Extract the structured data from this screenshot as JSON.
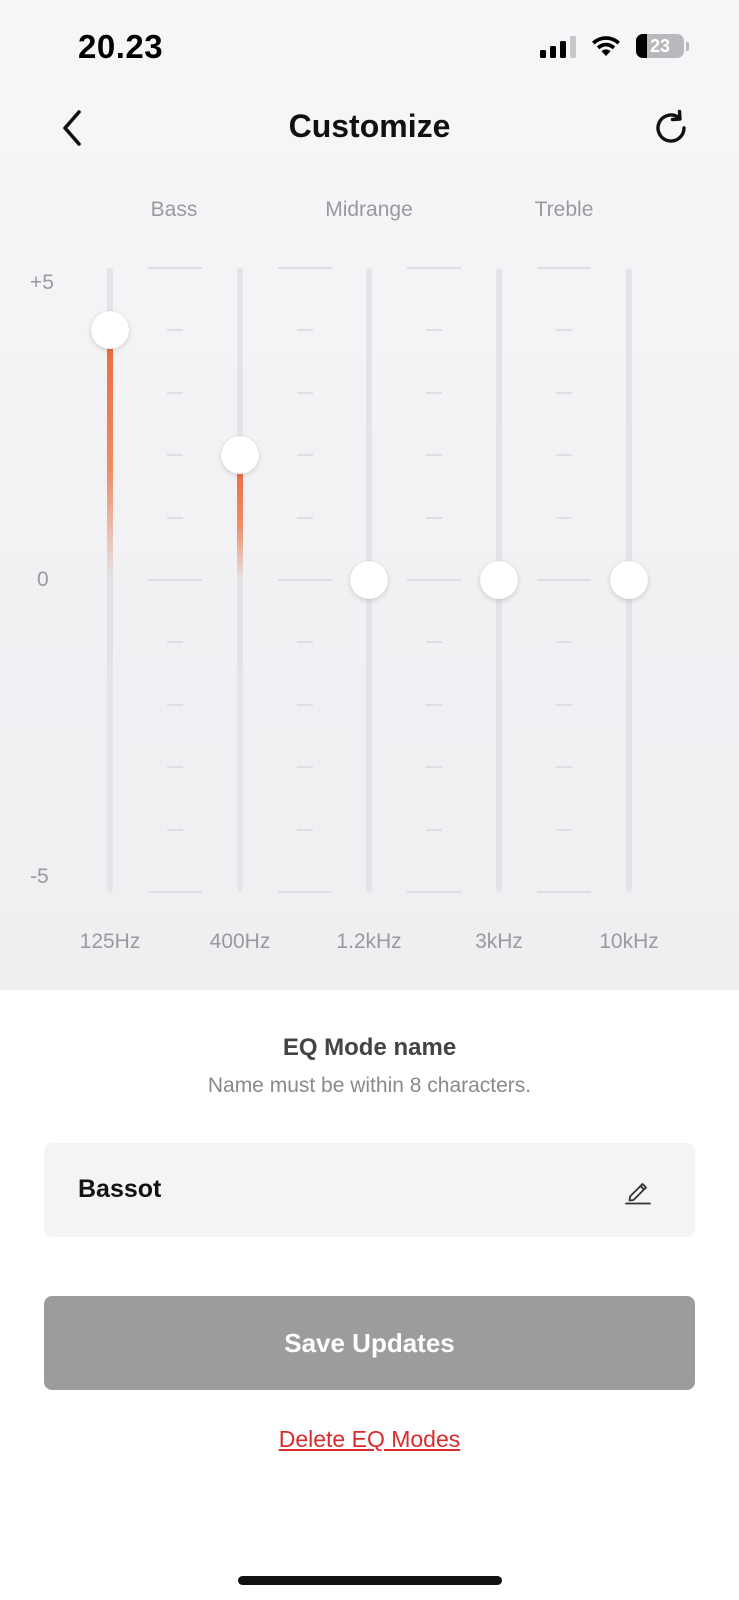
{
  "status_bar": {
    "time": "20.23",
    "battery_level": "23",
    "icons": [
      "cellular-signal-icon",
      "wifi-icon",
      "battery-icon"
    ]
  },
  "header": {
    "title": "Customize",
    "back_icon": "chevron-left-icon",
    "reset_icon": "refresh-icon"
  },
  "equalizer": {
    "groups": [
      "Bass",
      "Midrange",
      "Treble"
    ],
    "y_axis": {
      "max_label": "+5",
      "zero_label": "0",
      "min_label": "-5",
      "range": [
        -5,
        5
      ]
    },
    "bands": [
      {
        "label": "125Hz",
        "gain": 4
      },
      {
        "label": "400Hz",
        "gain": 2
      },
      {
        "label": "1.2kHz",
        "gain": 0
      },
      {
        "label": "3kHz",
        "gain": 0
      },
      {
        "label": "10kHz",
        "gain": 0
      }
    ],
    "accent_color": "#EE6A3A"
  },
  "mode_name": {
    "title": "EQ Mode name",
    "hint": "Name must be within 8 characters.",
    "value": "Bassot",
    "edit_icon": "pencil-icon"
  },
  "actions": {
    "save_label": "Save Updates",
    "delete_label": "Delete EQ Modes",
    "delete_color": "#D92C2C"
  }
}
